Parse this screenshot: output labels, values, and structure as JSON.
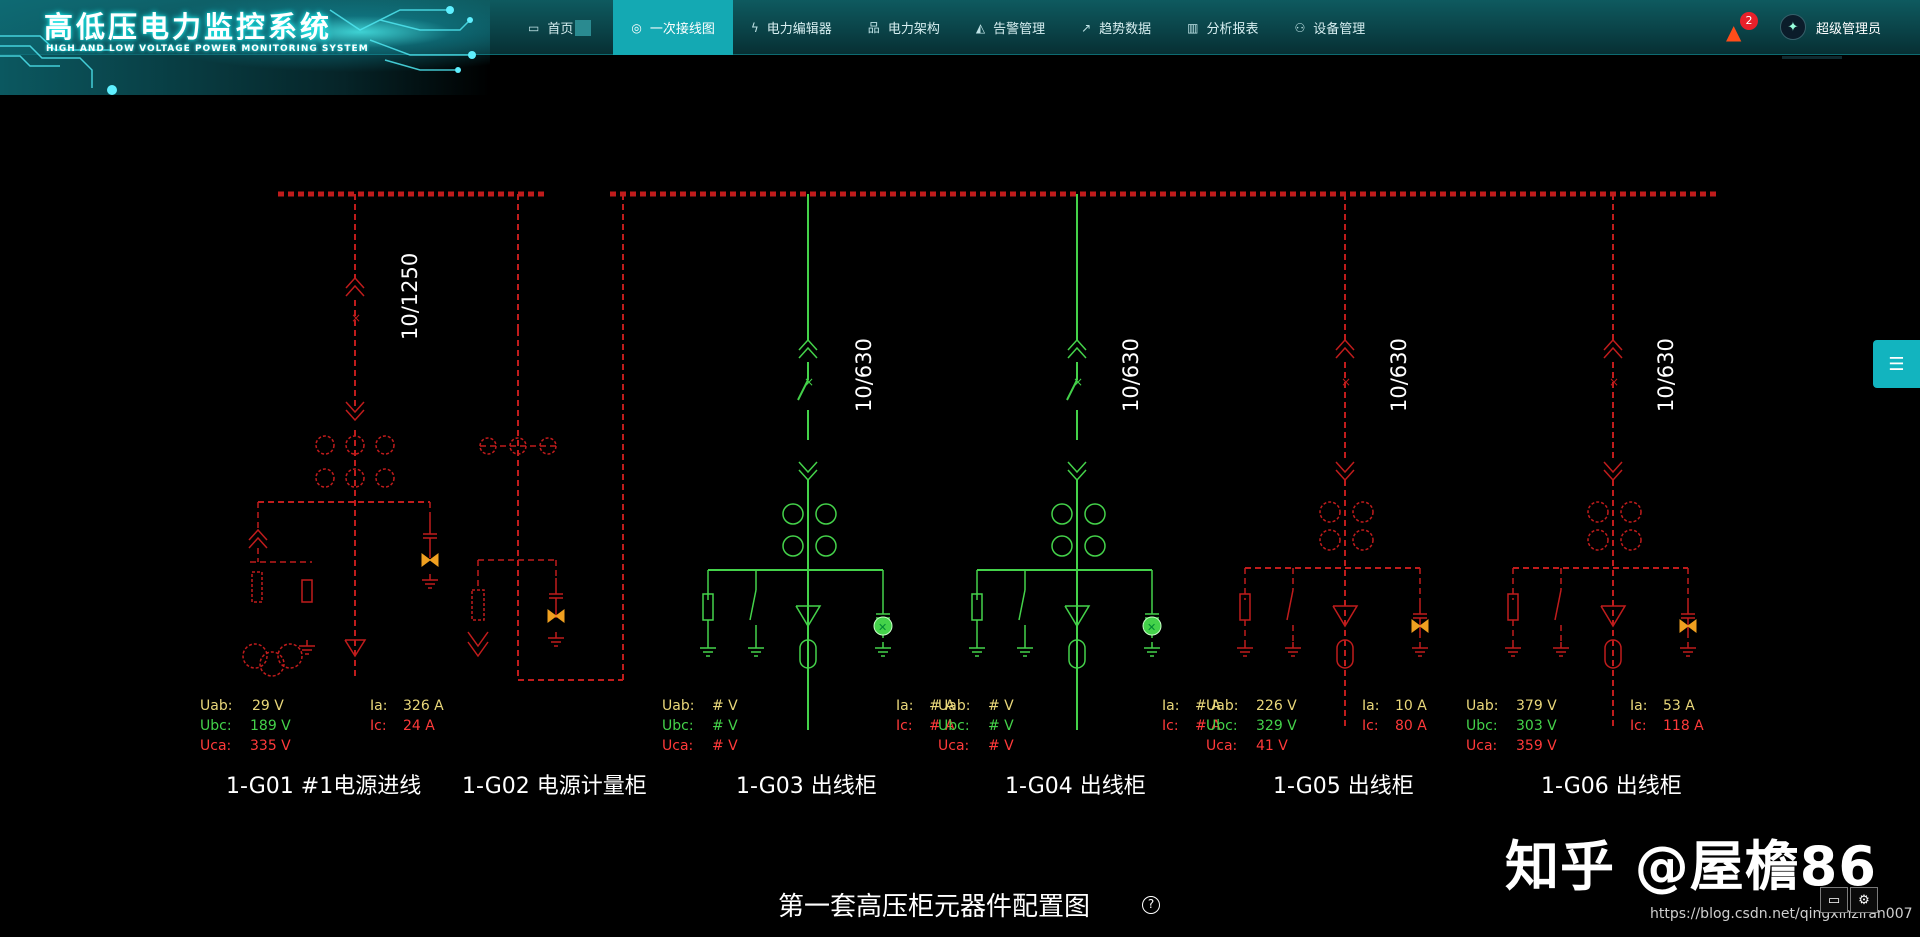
{
  "header": {
    "logo_title": "高低压电力监控系统",
    "logo_subtitle": "HIGH AND LOW VOLTAGE POWER MONITORING SYSTEM",
    "nav": [
      {
        "label": "首页",
        "icon": "monitor-icon",
        "active": false
      },
      {
        "label": "一次接线图",
        "icon": "globe-icon",
        "active": true
      },
      {
        "label": "电力编辑器",
        "icon": "lightning-icon",
        "active": false
      },
      {
        "label": "电力架构",
        "icon": "org-chart-icon",
        "active": false
      },
      {
        "label": "告警管理",
        "icon": "siren-icon",
        "active": false
      },
      {
        "label": "趋势数据",
        "icon": "trend-line-icon",
        "active": false
      },
      {
        "label": "分析报表",
        "icon": "bar-chart-icon",
        "active": false
      },
      {
        "label": "设备管理",
        "icon": "device-tree-icon",
        "active": false
      }
    ],
    "alarm_count": "2",
    "user_name": "超级管理员"
  },
  "colors": {
    "header_bg": "#0a4146",
    "nav_active": "#14a9b3",
    "energized": "#44d24a",
    "deenergized": "#c01c1c",
    "voltage_label": "#e9d77a"
  },
  "cabinets": [
    {
      "name": "1-G01 #1电源进线",
      "rating": "10/1250",
      "state": "off",
      "uab": "29 V",
      "ubc": "189 V",
      "uca": "335 V",
      "ia": "326 A",
      "ic": "24 A",
      "uab_label": "Uab:",
      "ubc_label": "Ubc:",
      "uca_label": "Uca:",
      "ia_label": "Ia:",
      "ic_label": "Ic:"
    },
    {
      "name": "1-G02 电源计量柜",
      "rating": "",
      "state": "off"
    },
    {
      "name": "1-G03 出线柜",
      "rating": "10/630",
      "state": "on",
      "uab": "# V",
      "ubc": "# V",
      "uca": "# V",
      "ia": "# A",
      "ic": "# A",
      "uab_label": "Uab:",
      "ubc_label": "Ubc:",
      "uca_label": "Uca:",
      "ia_label": "Ia:",
      "ic_label": "Ic:"
    },
    {
      "name": "1-G04 出线柜",
      "rating": "10/630",
      "state": "on",
      "uab": "# V",
      "ubc": "# V",
      "uca": "# V",
      "ia": "# A",
      "ic": "# A",
      "uab_label": "Uab:",
      "ubc_label": "Ubc:",
      "uca_label": "Uca:",
      "ia_label": "Ia:",
      "ic_label": "Ic:"
    },
    {
      "name": "1-G05 出线柜",
      "rating": "10/630",
      "state": "off",
      "uab": "226 V",
      "ubc": "329 V",
      "uca": "41 V",
      "ia": "10 A",
      "ic": "80 A",
      "uab_label": "Uab:",
      "ubc_label": "Ubc:",
      "uca_label": "Uca:",
      "ia_label": "Ia:",
      "ic_label": "Ic:"
    },
    {
      "name": "1-G06 出线柜",
      "rating": "10/630",
      "state": "off",
      "uab": "379 V",
      "ubc": "303 V",
      "uca": "359 V",
      "ia": "53 A",
      "ic": "118 A",
      "uab_label": "Uab:",
      "ubc_label": "Ubc:",
      "uca_label": "Uca:",
      "ia_label": "Ia:",
      "ic_label": "Ic:"
    }
  ],
  "caption": "第一套高压柜元器件配置图",
  "watermark": "知乎 @屋檐86",
  "source_url": "https://blog.csdn.net/qingxinziran007"
}
